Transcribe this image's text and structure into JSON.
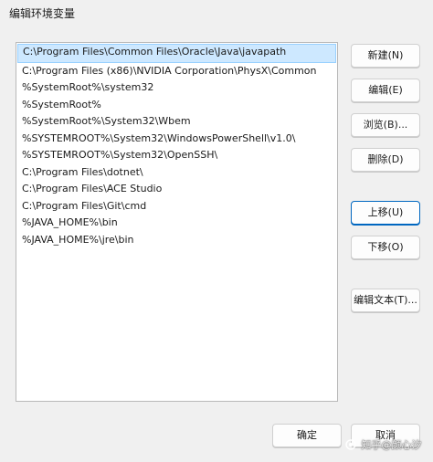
{
  "window": {
    "title": "编辑环境变量"
  },
  "paths": [
    "C:\\Program Files\\Common Files\\Oracle\\Java\\javapath",
    "C:\\Program Files (x86)\\NVIDIA Corporation\\PhysX\\Common",
    "%SystemRoot%\\system32",
    "%SystemRoot%",
    "%SystemRoot%\\System32\\Wbem",
    "%SYSTEMROOT%\\System32\\WindowsPowerShell\\v1.0\\",
    "%SYSTEMROOT%\\System32\\OpenSSH\\",
    "C:\\Program Files\\dotnet\\",
    "C:\\Program Files\\ACE Studio",
    "C:\\Program Files\\Git\\cmd",
    "%JAVA_HOME%\\bin",
    "%JAVA_HOME%\\jre\\bin"
  ],
  "selected_index": 0,
  "buttons": {
    "new": "新建(N)",
    "edit": "编辑(E)",
    "browse": "浏览(B)...",
    "delete": "删除(D)",
    "move_up": "上移(U)",
    "move_down": "下移(O)",
    "edit_text": "编辑文本(T)...",
    "ok": "确定",
    "cancel": "取消"
  },
  "watermark": {
    "text": "知乎@颜心汐"
  }
}
